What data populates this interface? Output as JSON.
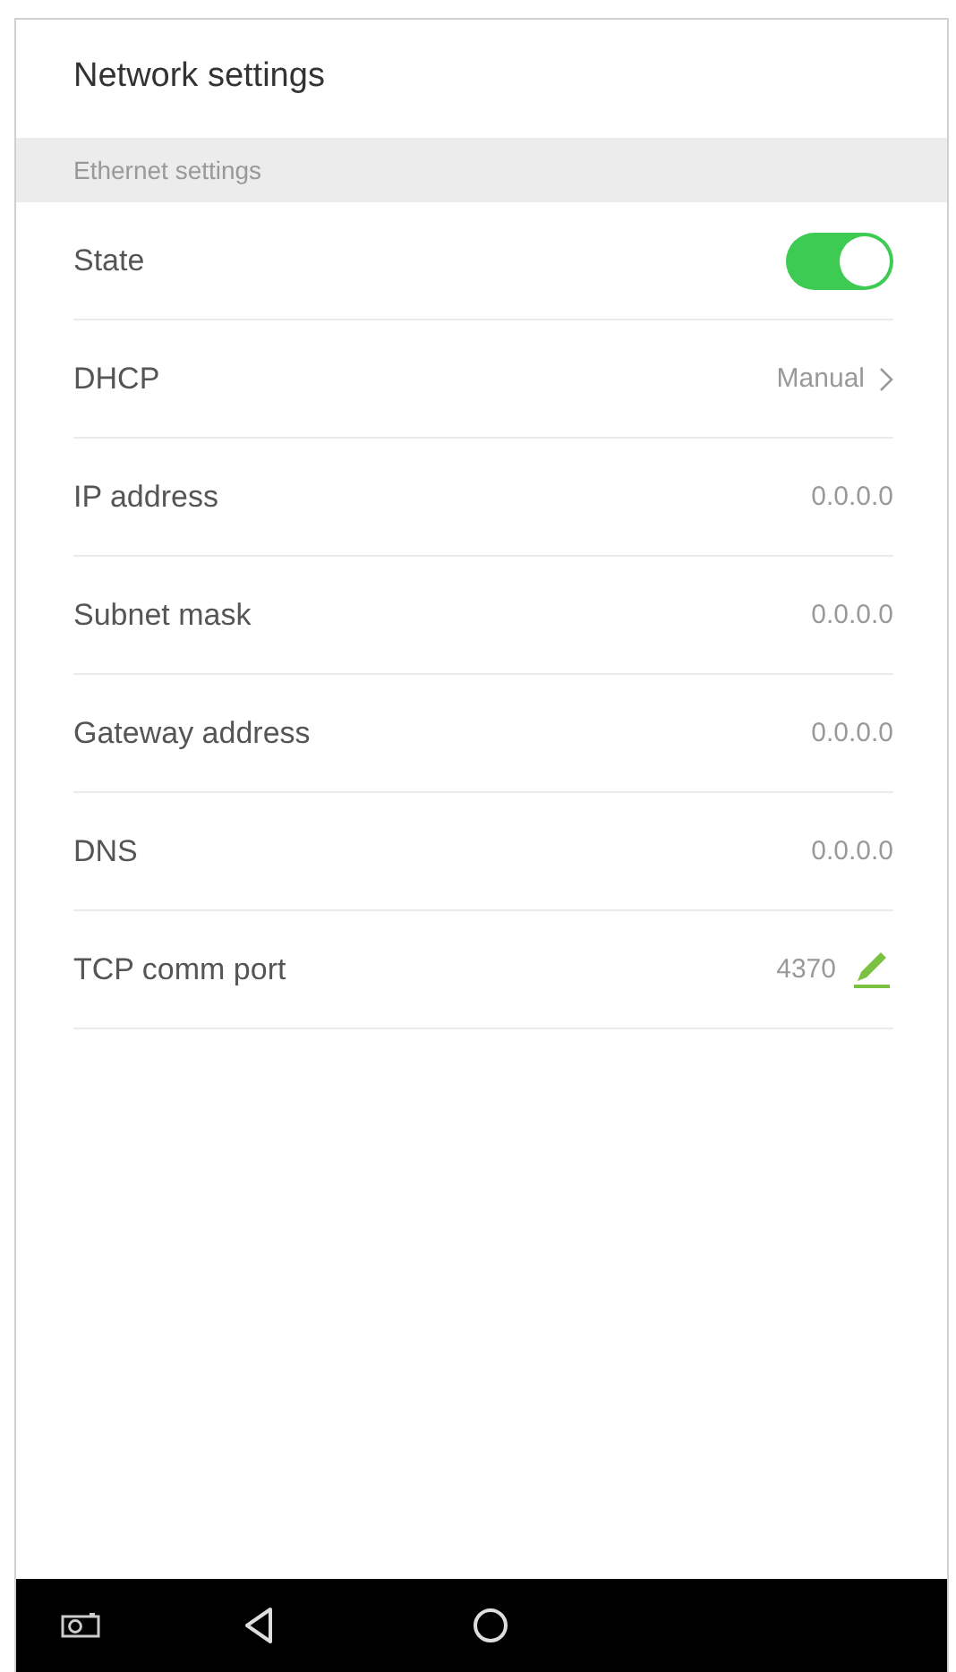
{
  "header": {
    "title": "Network settings"
  },
  "section": {
    "title": "Ethernet settings"
  },
  "rows": [
    {
      "kind": "toggle",
      "label": "State",
      "on": true
    },
    {
      "kind": "link",
      "label": "DHCP",
      "value": "Manual"
    },
    {
      "kind": "value",
      "label": "IP address",
      "value": "0.0.0.0"
    },
    {
      "kind": "value",
      "label": "Subnet mask",
      "value": "0.0.0.0"
    },
    {
      "kind": "value",
      "label": "Gateway address",
      "value": "0.0.0.0"
    },
    {
      "kind": "value",
      "label": "DNS",
      "value": "0.0.0.0"
    },
    {
      "kind": "edit",
      "label": "TCP comm port",
      "value": "4370"
    }
  ]
}
